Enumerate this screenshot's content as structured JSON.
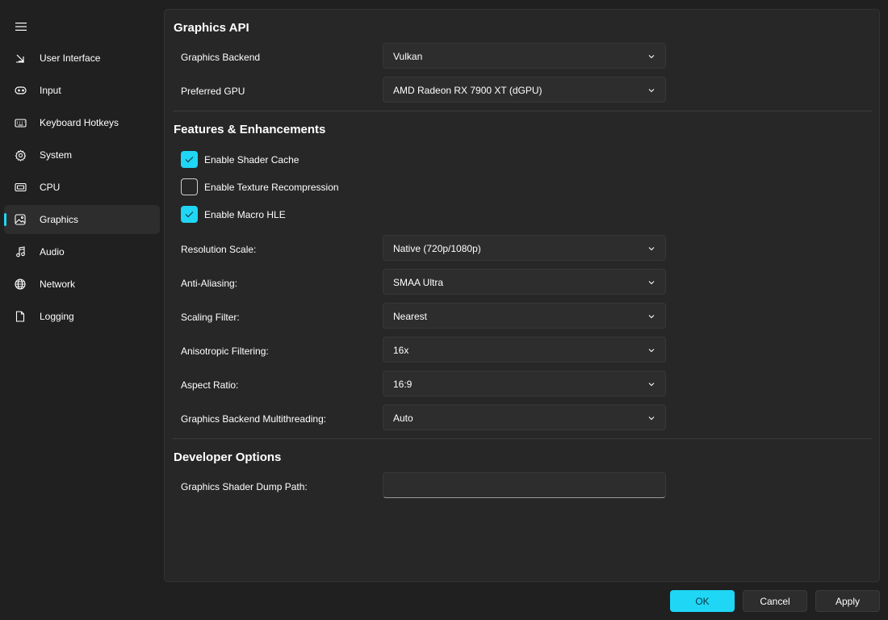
{
  "colors": {
    "accent": "#1fd6f5",
    "background": "#202020",
    "panel": "#272727",
    "control": "#2d2d2d"
  },
  "sidebar": {
    "menu_icon": "hamburger-icon",
    "items": [
      {
        "label": "User Interface",
        "icon": "arrow-down-right-icon"
      },
      {
        "label": "Input",
        "icon": "gamepad-icon"
      },
      {
        "label": "Keyboard Hotkeys",
        "icon": "keyboard-icon"
      },
      {
        "label": "System",
        "icon": "gear-icon"
      },
      {
        "label": "CPU",
        "icon": "cpu-icon"
      },
      {
        "label": "Graphics",
        "icon": "image-icon",
        "active": true
      },
      {
        "label": "Audio",
        "icon": "music-note-icon"
      },
      {
        "label": "Network",
        "icon": "globe-icon"
      },
      {
        "label": "Logging",
        "icon": "document-icon"
      }
    ]
  },
  "graphics_api": {
    "title": "Graphics API",
    "backend_label": "Graphics Backend",
    "backend_value": "Vulkan",
    "gpu_label": "Preferred GPU",
    "gpu_value": "AMD Radeon RX 7900 XT (dGPU)"
  },
  "features": {
    "title": "Features & Enhancements",
    "checkboxes": [
      {
        "label": "Enable Shader Cache",
        "checked": true
      },
      {
        "label": "Enable Texture Recompression",
        "checked": false
      },
      {
        "label": "Enable Macro HLE",
        "checked": true
      }
    ],
    "settings": [
      {
        "label": "Resolution Scale:",
        "value": "Native (720p/1080p)"
      },
      {
        "label": "Anti-Aliasing:",
        "value": "SMAA Ultra"
      },
      {
        "label": "Scaling Filter:",
        "value": "Nearest"
      },
      {
        "label": "Anisotropic Filtering:",
        "value": "16x"
      },
      {
        "label": "Aspect Ratio:",
        "value": "16:9"
      },
      {
        "label": "Graphics Backend Multithreading:",
        "value": "Auto"
      }
    ]
  },
  "developer": {
    "title": "Developer Options",
    "dump_path_label": "Graphics Shader Dump Path:",
    "dump_path_value": ""
  },
  "footer": {
    "ok_label": "OK",
    "cancel_label": "Cancel",
    "apply_label": "Apply"
  }
}
